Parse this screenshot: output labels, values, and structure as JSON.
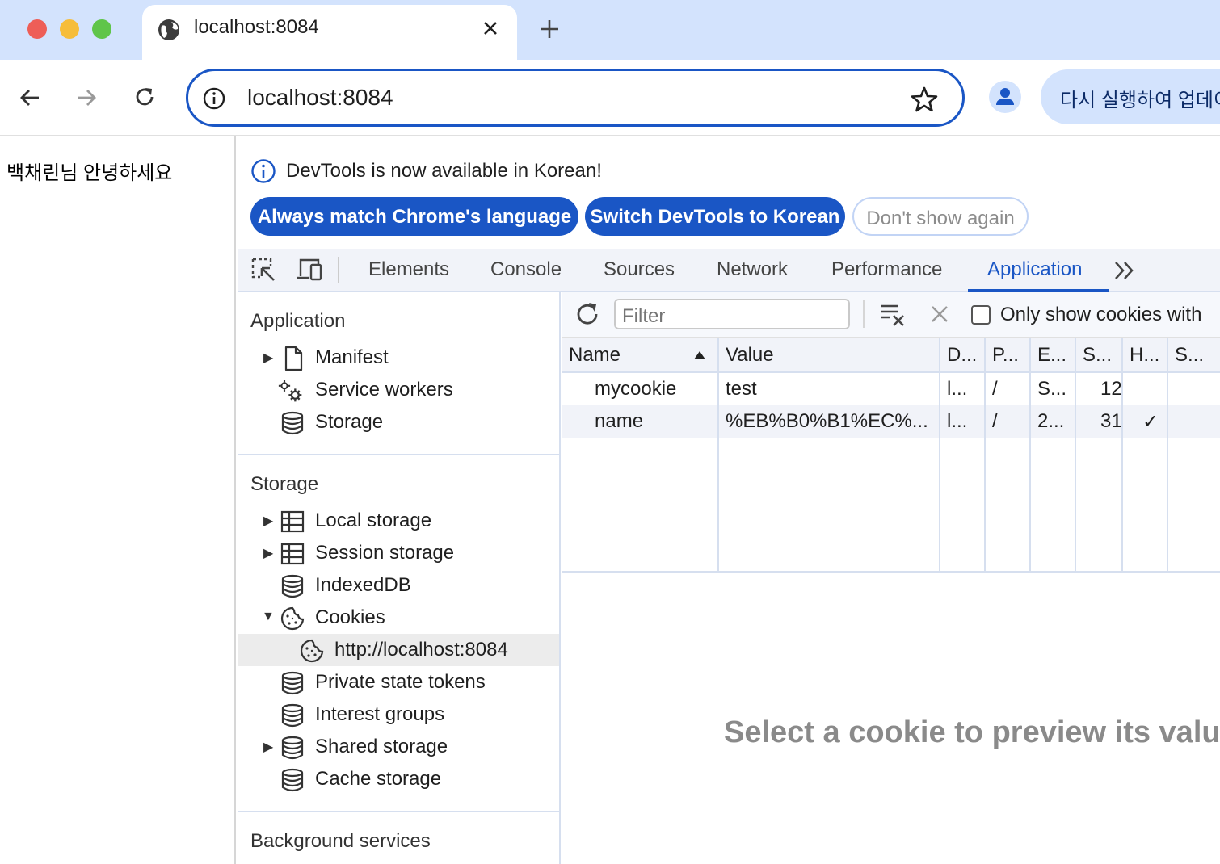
{
  "browser": {
    "tab_title": "localhost:8084",
    "url": "localhost:8084",
    "update_button": "다시 실행하여 업데이트"
  },
  "page": {
    "greeting": "백채린님  안녕하세요"
  },
  "infobar": {
    "message": "DevTools is now available in Korean!",
    "btn_match": "Always match Chrome's language",
    "btn_switch": "Switch DevTools to Korean",
    "btn_dont_show": "Don't show again"
  },
  "devtools_tabs": [
    "Elements",
    "Console",
    "Sources",
    "Network",
    "Performance",
    "Application"
  ],
  "sidebar": {
    "application_title": "Application",
    "application_items": [
      "Manifest",
      "Service workers",
      "Storage"
    ],
    "storage_title": "Storage",
    "storage_items": [
      "Local storage",
      "Session storage",
      "IndexedDB",
      "Cookies",
      "http://localhost:8084",
      "Private state tokens",
      "Interest groups",
      "Shared storage",
      "Cache storage"
    ],
    "background_title": "Background services"
  },
  "cookies": {
    "filter_placeholder": "Filter",
    "only_show_label": "Only show cookies with",
    "columns": [
      "Name",
      "Value",
      "D...",
      "P...",
      "E...",
      "S...",
      "H...",
      "S..."
    ],
    "rows": [
      {
        "name": "mycookie",
        "value": "test",
        "domain": "l...",
        "path": "/",
        "expires": "S...",
        "size": "12",
        "httponly": "",
        "secure": ""
      },
      {
        "name": "name",
        "value": "%EB%B0%B1%EC%...",
        "domain": "l...",
        "path": "/",
        "expires": "2...",
        "size": "31",
        "httponly": "✓",
        "secure": ""
      }
    ],
    "preview_message": "Select a cookie to preview its value"
  },
  "colors": {
    "accent": "#1a56c5",
    "tabbar": "#d3e3fd"
  }
}
